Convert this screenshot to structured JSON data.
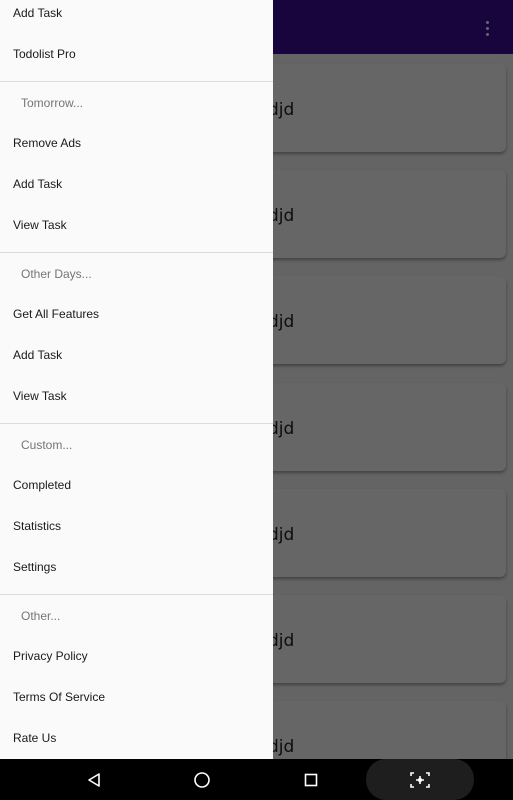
{
  "task_list": {
    "items": [
      {
        "text": "djd"
      },
      {
        "text": "djd"
      },
      {
        "text": "djd"
      },
      {
        "text": "djd"
      },
      {
        "text": "djd"
      },
      {
        "text": "djd"
      },
      {
        "text": "djd"
      }
    ]
  },
  "toolbar": {
    "overflow_icon": "more-vert-icon",
    "color": "#3d0d9c"
  },
  "drawer": {
    "section_today": {
      "items": [
        "Add Task",
        "Todolist Pro"
      ]
    },
    "section_tomorrow": {
      "header": "Tomorrow...",
      "items": [
        "Remove Ads",
        "Add Task",
        "View Task"
      ]
    },
    "section_other_days": {
      "header": "Other Days...",
      "items": [
        "Get All Features",
        "Add Task",
        "View Task"
      ]
    },
    "section_custom": {
      "header": "Custom...",
      "items": [
        "Completed",
        "Statistics",
        "Settings"
      ]
    },
    "section_other": {
      "header": "Other...",
      "items": [
        "Privacy Policy",
        "Terms Of Service",
        "Rate Us"
      ]
    }
  },
  "navbar": {
    "back_icon": "back-triangle-icon",
    "home_icon": "home-circle-icon",
    "recents_icon": "recents-square-icon",
    "extra_icon": "screenshot-icon"
  }
}
